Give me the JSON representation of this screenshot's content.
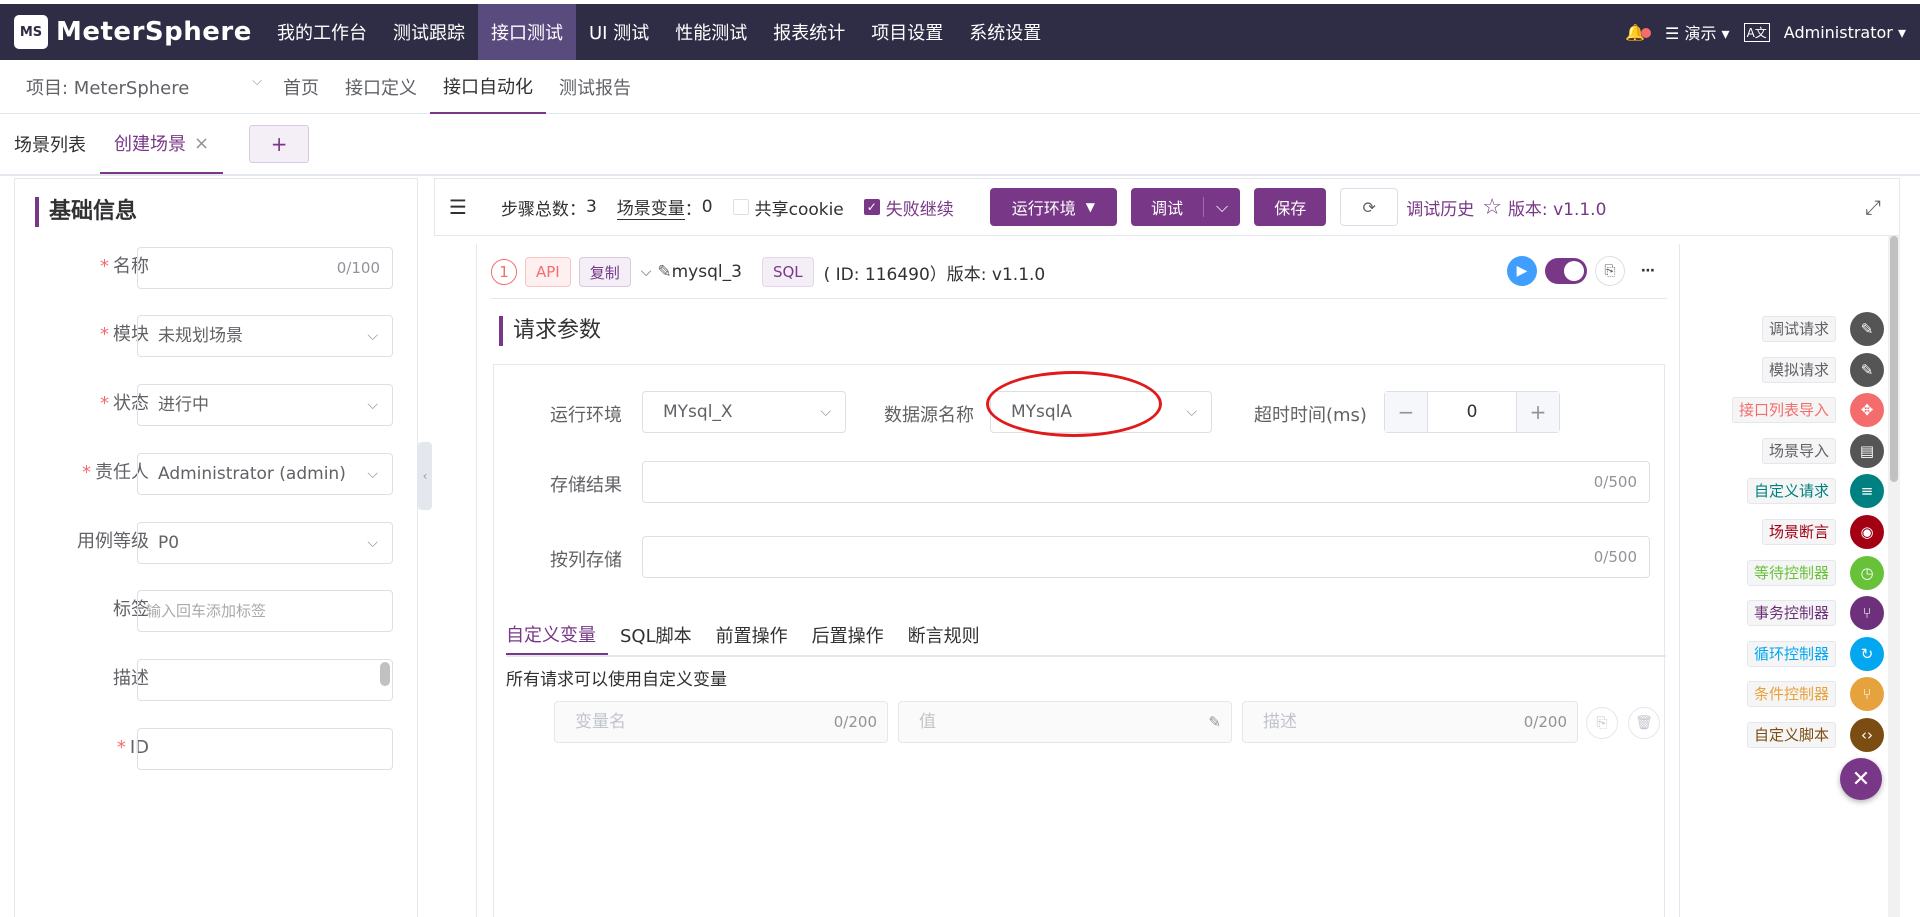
{
  "topnav": {
    "brand": "MeterSphere",
    "logo_mark": "MS",
    "items": [
      "我的工作台",
      "测试跟踪",
      "接口测试",
      "UI 测试",
      "性能测试",
      "报表统计",
      "项目设置",
      "系统设置"
    ],
    "active_index": 2,
    "workspace": "演示",
    "user": "Administrator"
  },
  "projnav": {
    "project": "项目: MeterSphere",
    "items": [
      "首页",
      "接口定义",
      "接口自动化",
      "测试报告"
    ],
    "active_index": 2
  },
  "scene_tabs": {
    "list": "场景列表",
    "create": "创建场景",
    "close": "×",
    "add": "+"
  },
  "basic_info": {
    "title": "基础信息",
    "fields": {
      "name": {
        "label": "名称",
        "value": "",
        "counter": "0/100"
      },
      "module": {
        "label": "模块",
        "value": "未规划场景"
      },
      "status": {
        "label": "状态",
        "value": "进行中"
      },
      "owner": {
        "label": "责任人",
        "value": "Administrator (admin)"
      },
      "level": {
        "label": "用例等级",
        "value": "P0"
      },
      "tags": {
        "label": "标签",
        "placeholder": "输入回车添加标签"
      },
      "desc": {
        "label": "描述",
        "value": ""
      },
      "id": {
        "label": "ID",
        "value": ""
      }
    }
  },
  "toolbar": {
    "steps_label": "步骤总数",
    "steps_count": "3",
    "vars_label": "场景变量",
    "vars_count": "0",
    "share_cookie": "共享cookie",
    "share_cookie_checked": false,
    "continue_on_fail": "失败继续",
    "continue_on_fail_checked": true,
    "env_button": "运行环境",
    "debug_button": "调试",
    "save_button": "保存",
    "history": "调试历史",
    "version": "版本: v1.1.0"
  },
  "step": {
    "index": "1",
    "tag_api": "API",
    "tag_copy": "复制",
    "name": "mysql_3",
    "tag_sql": "SQL",
    "meta": "( ID: 116490）版本: v1.1.0",
    "request_title": "请求参数",
    "env_label": "运行环境",
    "env_value": "MYsql_X",
    "datasource_label": "数据源名称",
    "datasource_value": "MYsqlA",
    "timeout_label": "超时时间(ms)",
    "timeout_value": "0",
    "store_result_label": "存储结果",
    "store_result_counter": "0/500",
    "store_by_column_label": "按列存储",
    "store_by_column_counter": "0/500",
    "subtabs": [
      "自定义变量",
      "SQL脚本",
      "前置操作",
      "后置操作",
      "断言规则"
    ],
    "active_subtab": 0,
    "var_hint": "所有请求可以使用自定义变量",
    "var_name_placeholder": "变量名",
    "var_name_counter": "0/200",
    "var_value_placeholder": "值",
    "var_desc_placeholder": "描述",
    "var_desc_counter": "0/200"
  },
  "quick_menu": [
    {
      "label": "调试请求",
      "color": "#555555",
      "label_color": "#606266"
    },
    {
      "label": "模拟请求",
      "color": "#555555",
      "label_color": "#606266"
    },
    {
      "label": "接口列表导入",
      "color": "#f56c6c",
      "label_color": "#f56c6c"
    },
    {
      "label": "场景导入",
      "color": "#555555",
      "label_color": "#606266"
    },
    {
      "label": "自定义请求",
      "color": "#008080",
      "label_color": "#008080"
    },
    {
      "label": "场景断言",
      "color": "#a30014",
      "label_color": "#a30014"
    },
    {
      "label": "等待控制器",
      "color": "#67c23a",
      "label_color": "#67c23a"
    },
    {
      "label": "事务控制器",
      "color": "#6d317c",
      "label_color": "#6d317c"
    },
    {
      "label": "循环控制器",
      "color": "#02a7f0",
      "label_color": "#02a7f0"
    },
    {
      "label": "条件控制器",
      "color": "#e6a23c",
      "label_color": "#e6a23c"
    },
    {
      "label": "自定义脚本",
      "color": "#7b4d12",
      "label_color": "#7b4d12"
    }
  ],
  "colors": {
    "accent": "#783887",
    "nav_bg": "#2f2d45",
    "annotation": "#e0191b"
  }
}
